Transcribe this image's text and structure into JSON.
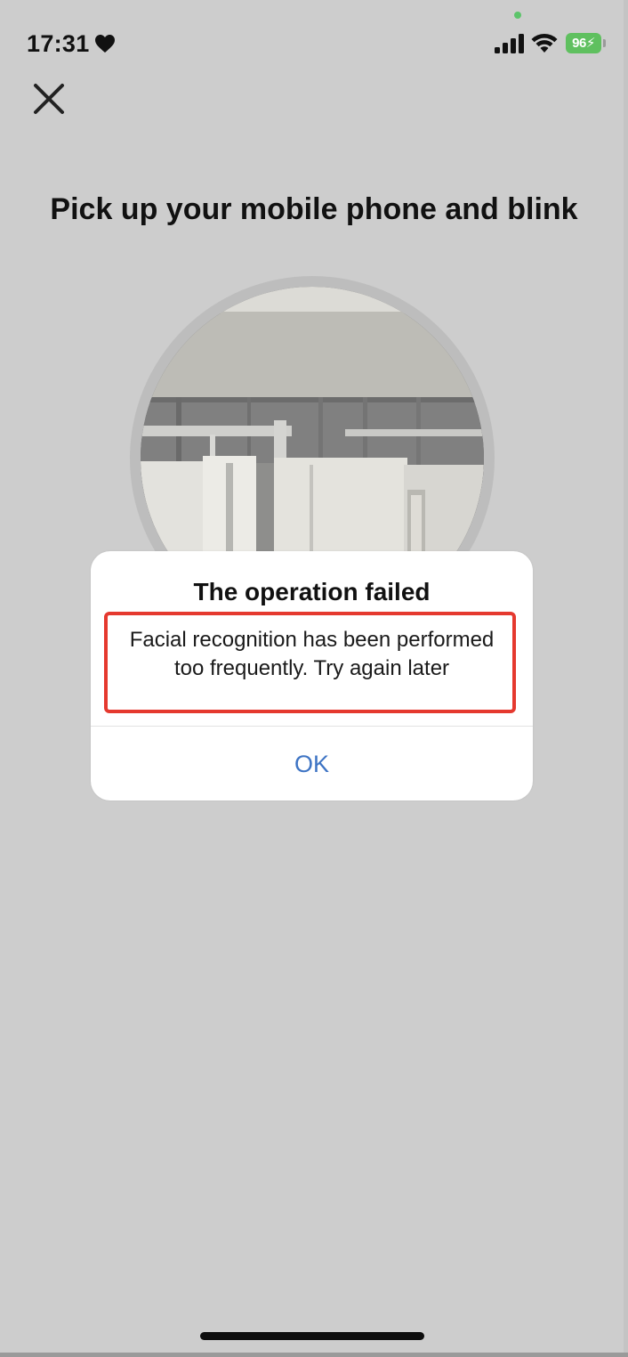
{
  "status_bar": {
    "time": "17:31",
    "battery_level": "96",
    "icons": [
      "heart-icon",
      "signal-icon",
      "wifi-icon",
      "battery-icon"
    ],
    "battery_color": "#5fc05f"
  },
  "header": {
    "close_icon": "close-icon"
  },
  "main": {
    "instruction": "Pick up your mobile phone and blink"
  },
  "dialog": {
    "title": "The operation failed",
    "message": "Facial recognition has been performed too frequently. Try again later",
    "ok_label": "OK",
    "highlight_color": "#e5392f",
    "button_color": "#3e74c4"
  }
}
